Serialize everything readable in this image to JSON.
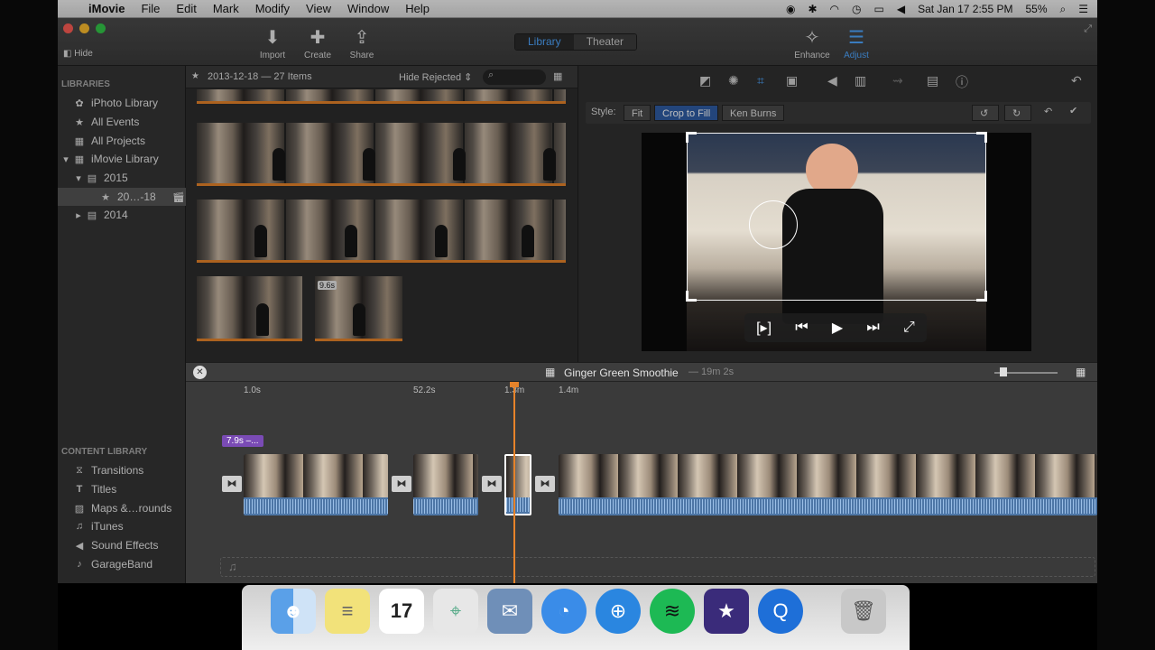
{
  "menubar": {
    "app": "iMovie",
    "items": [
      "File",
      "Edit",
      "Mark",
      "Modify",
      "View",
      "Window",
      "Help"
    ],
    "battery": "55%",
    "clock": "Sat Jan 17  2:55 PM"
  },
  "toolbar": {
    "hide_label": "Hide",
    "import_label": "Import",
    "create_label": "Create",
    "share_label": "Share",
    "library_tab": "Library",
    "theater_tab": "Theater",
    "enhance_label": "Enhance",
    "adjust_label": "Adjust"
  },
  "sidebar": {
    "libraries_header": "LIBRARIES",
    "items": [
      {
        "label": "iPhoto Library"
      },
      {
        "label": "All Events"
      },
      {
        "label": "All Projects"
      },
      {
        "label": "iMovie Library"
      },
      {
        "label": "2015"
      },
      {
        "label": "20…-18"
      },
      {
        "label": "2014"
      }
    ],
    "content_header": "CONTENT LIBRARY",
    "content_items": [
      {
        "label": "Transitions"
      },
      {
        "label": "Titles"
      },
      {
        "label": "Maps &…rounds"
      },
      {
        "label": "iTunes"
      },
      {
        "label": "Sound Effects"
      },
      {
        "label": "GarageBand"
      }
    ]
  },
  "browser": {
    "event_title": "2013-12-18 — 27 Items",
    "filter_label": "Hide Rejected",
    "clip_duration_badge": "9.6s"
  },
  "viewer": {
    "style_label": "Style:",
    "style_options": [
      "Fit",
      "Crop to Fill",
      "Ken Burns"
    ],
    "selected_style": "Crop to Fill"
  },
  "timeline": {
    "project_title": "Ginger Green Smoothie",
    "project_duration": "— 19m 2s",
    "ruler": [
      "1.0s",
      "52.2s",
      "1.3m",
      "1.4m"
    ],
    "clip_badge": "7.9s –..."
  },
  "colors": {
    "accent_blue": "#4ea6ff",
    "playhead_orange": "#e6832a",
    "selected_style_bg": "#2f5da5"
  }
}
